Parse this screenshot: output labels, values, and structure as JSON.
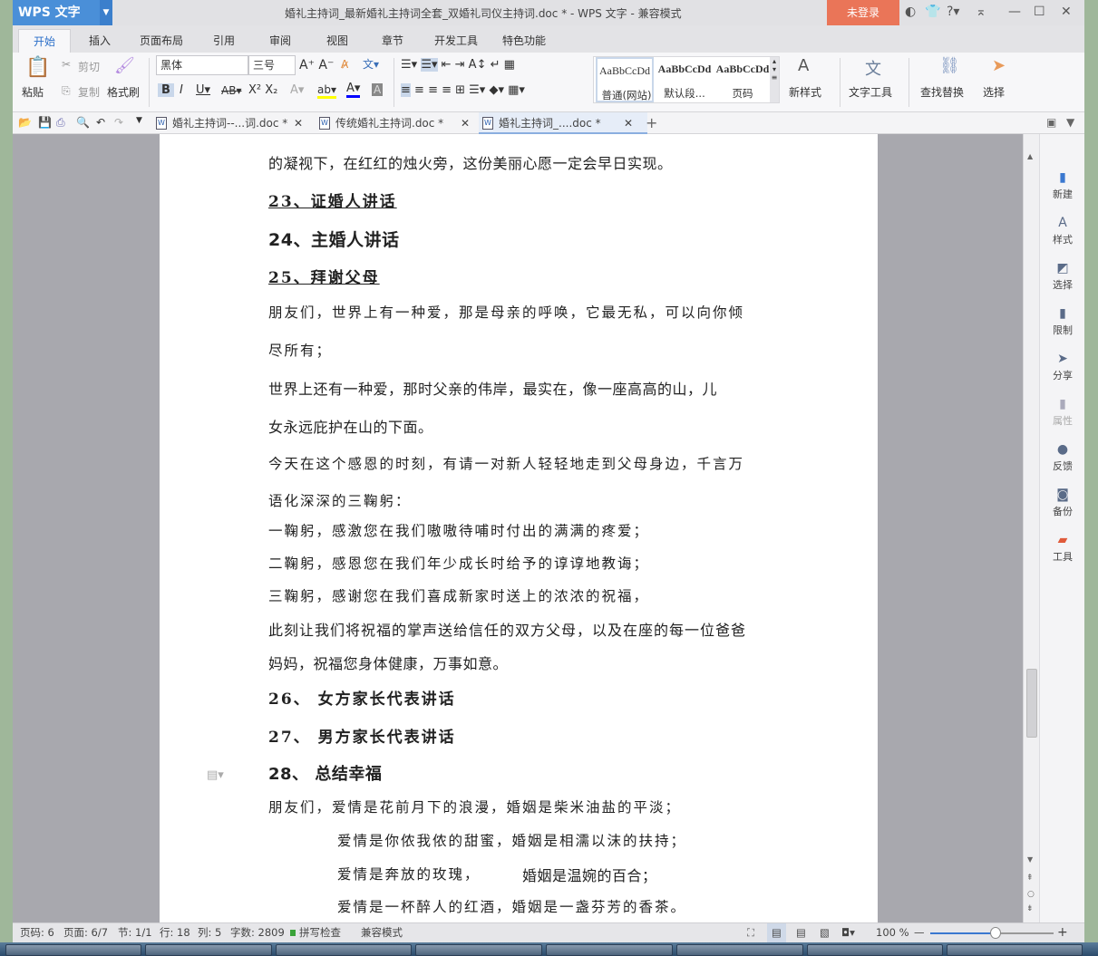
{
  "app": {
    "name": "WPS 文字",
    "title": "婚礼主持词_最新婚礼主持词全套_双婚礼司仪主持词.doc * - WPS 文字 - 兼容模式",
    "login": "未登录"
  },
  "menu_tabs": [
    "开始",
    "插入",
    "页面布局",
    "引用",
    "审阅",
    "视图",
    "章节",
    "开发工具",
    "特色功能"
  ],
  "toolbar": {
    "paste": "粘贴",
    "cut": "剪切",
    "copy": "复制",
    "format_painter": "格式刷",
    "font": "黑体",
    "font_size": "三号",
    "styles": [
      {
        "preview": "AaBbCcDd",
        "label": "普通(网站)"
      },
      {
        "preview": "AaBbCcDd",
        "label": "默认段..."
      },
      {
        "preview": "AaBbCcDd",
        "label": "页码"
      }
    ],
    "new_style": "新样式",
    "text_tools": "文字工具",
    "find_replace": "查找替换",
    "select": "选择"
  },
  "doc_tabs": [
    {
      "label": "婚礼主持词--...词.doc *"
    },
    {
      "label": "传统婚礼主持词.doc *"
    },
    {
      "label": "婚礼主持词_....doc *"
    }
  ],
  "document": {
    "lines": [
      "的凝视下，在红红的烛火旁，这份美丽心愿一定会早日实现。",
      "23、证婚人讲话",
      "24、主婚人讲话",
      "25、拜谢父母",
      "朋友们，世界上有一种爱，那是母亲的呼唤，它最无私，可以向你倾",
      "尽所有；",
      "世界上还有一种爱，那时父亲的伟岸，最实在，像一座高高的山，儿",
      "女永远庇护在山的下面。",
      "今天在这个感恩的时刻，有请一对新人轻轻地走到父母身边，千言万",
      "语化深深的三鞠躬：",
      "一鞠躬，感激您在我们嗷嗷待哺时付出的满满的疼爱；",
      "二鞠躬，感恩您在我们年少成长时给予的谆谆地教诲；",
      "三鞠躬，感谢您在我们喜成新家时送上的浓浓的祝福，",
      "此刻让我们将祝福的掌声送给信任的双方父母，以及在座的每一位爸爸",
      "妈妈，祝福您身体健康，万事如意。",
      "26、 女方家长代表讲话",
      "27、 男方家长代表讲话",
      "28、 总结幸福",
      "朋友们，爱情是花前月下的浪漫，婚姻是柴米油盐的平淡；",
      "爱情是你侬我侬的甜蜜，婚姻是相濡以沫的扶持；",
      "爱情是奔放的玫瑰，",
      "婚姻是温婉的百合；",
      "爱情是一杯醉人的红酒，婚姻是一盏芬芳的香茶。"
    ]
  },
  "right_panel": [
    "新建",
    "样式",
    "选择",
    "限制",
    "分享",
    "属性",
    "反馈",
    "备份",
    "工具"
  ],
  "status": {
    "page_no": "页码: 6",
    "pages": "页面: 6/7",
    "section": "节: 1/1",
    "row": "行: 18",
    "col": "列: 5",
    "words": "字数: 2809",
    "spell": "拼写检查",
    "mode": "兼容模式",
    "zoom": "100 %"
  },
  "zoom_percent": 100
}
